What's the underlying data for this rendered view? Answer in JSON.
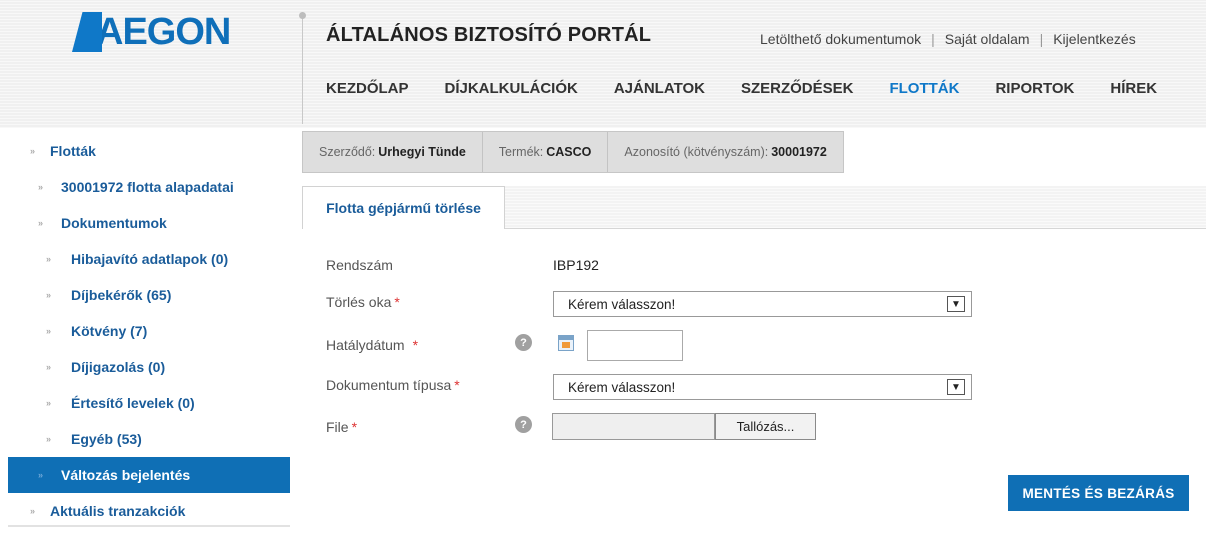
{
  "header": {
    "logo_text": "AEGON",
    "portal_title": "ÁLTALÁNOS BIZTOSÍTÓ PORTÁL",
    "top_links": [
      "Letölthető dokumentumok",
      "Saját oldalam",
      "Kijelentkezés"
    ],
    "nav": [
      "KEZDŐLAP",
      "DÍJKALKULÁCIÓK",
      "AJÁNLATOK",
      "SZERZŐDÉSEK",
      "FLOTTÁK",
      "RIPORTOK",
      "HÍREK"
    ],
    "active_nav": "FLOTTÁK"
  },
  "sidebar": {
    "items": [
      {
        "label": "Flották"
      },
      {
        "label": "30001972 flotta alapadatai"
      },
      {
        "label": "Dokumentumok"
      },
      {
        "label": "Hibajavító adatlapok (0)"
      },
      {
        "label": "Díjbekérők (65)"
      },
      {
        "label": "Kötvény (7)"
      },
      {
        "label": "Díjigazolás (0)"
      },
      {
        "label": "Értesítő levelek (0)"
      },
      {
        "label": "Egyéb (53)"
      },
      {
        "label": "Változás bejelentés"
      },
      {
        "label": "Aktuális tranzakciók"
      }
    ],
    "active_item": "Változás bejelentés"
  },
  "infobar": {
    "contractor_label": "Szerződő:",
    "contractor_value": "Urhegyi Tünde",
    "product_label": "Termék:",
    "product_value": "CASCO",
    "id_label": "Azonosító (kötvényszám):",
    "id_value": "30001972"
  },
  "tab": {
    "label": "Flotta gépjármű törlése"
  },
  "form": {
    "plate_label": "Rendszám",
    "plate_value": "IBP192",
    "reason_label": "Törlés oka",
    "reason_value": "Kérem válasszon!",
    "effective_date_label": "Hatálydátum",
    "effective_date_value": "",
    "doc_type_label": "Dokumentum típusa",
    "doc_type_value": "Kérem válasszon!",
    "file_label": "File",
    "required_marker": "*",
    "help_glyph": "?",
    "browse_label": "Tallózás...",
    "save_label": "MENTÉS ÉS BEZÁRÁS"
  },
  "colors": {
    "brand_blue": "#0f6fb5",
    "link_blue": "#1a5c9a",
    "required_red": "#d33333"
  },
  "icons": {
    "help": "help-question-icon",
    "calendar": "calendar-icon",
    "dropdown": "chevron-down-icon",
    "sidebar_bullet": "double-chevron-right-icon"
  }
}
